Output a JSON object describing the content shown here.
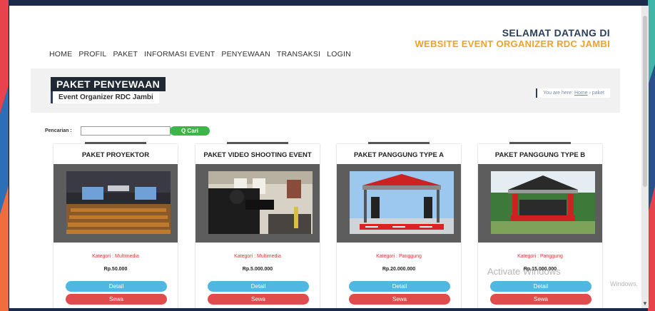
{
  "header": {
    "welcome_line1": "SELAMAT DATANG DI",
    "welcome_line2": "WEBSITE EVENT ORGANIZER RDC JAMBI"
  },
  "nav": [
    "HOME",
    "PROFIL",
    "PAKET",
    "INFORMASI EVENT",
    "PENYEWAAN",
    "TRANSAKSI",
    "LOGIN"
  ],
  "banner": {
    "title": "PAKET PENYEWAAN",
    "subtitle": "Event Organizer RDC Jambi",
    "breadcrumb_prefix": "You are here:",
    "breadcrumb_home": "Home",
    "breadcrumb_sep": "›",
    "breadcrumb_current": "paket"
  },
  "search": {
    "label": "Pencarian :",
    "value": "",
    "button_label": "Q Cari"
  },
  "cards": [
    {
      "title": "PAKET PROYEKTOR",
      "category": "Kategori : Multimedia",
      "price": "Rp.50.000",
      "detail_label": "Detail",
      "rent_label": "Sewa"
    },
    {
      "title": "PAKET VIDEO SHOOTING EVENT",
      "category": "Kategori : Multimedia",
      "price": "Rp.5.000.000",
      "detail_label": "Detail",
      "rent_label": "Sewa"
    },
    {
      "title": "PAKET PANGGUNG TYPE A",
      "category": "Kategori : Panggung",
      "price": "Rp.20.000.000",
      "detail_label": "Detail",
      "rent_label": "Sewa"
    },
    {
      "title": "PAKET PANGGUNG TYPE B",
      "category": "Kategori : Panggung",
      "price": "Rp.15.000.000",
      "detail_label": "Detail",
      "rent_label": "Sewa"
    }
  ],
  "watermark": {
    "line1": "Activate Windows",
    "line2": "Windows."
  },
  "colors": {
    "accent_orange": "#f0a226",
    "navy": "#2b3f5c",
    "button_green": "#3db54a",
    "detail_blue": "#4fb7e2",
    "sewa_red": "#e04b4b",
    "category_red": "#e03434"
  }
}
